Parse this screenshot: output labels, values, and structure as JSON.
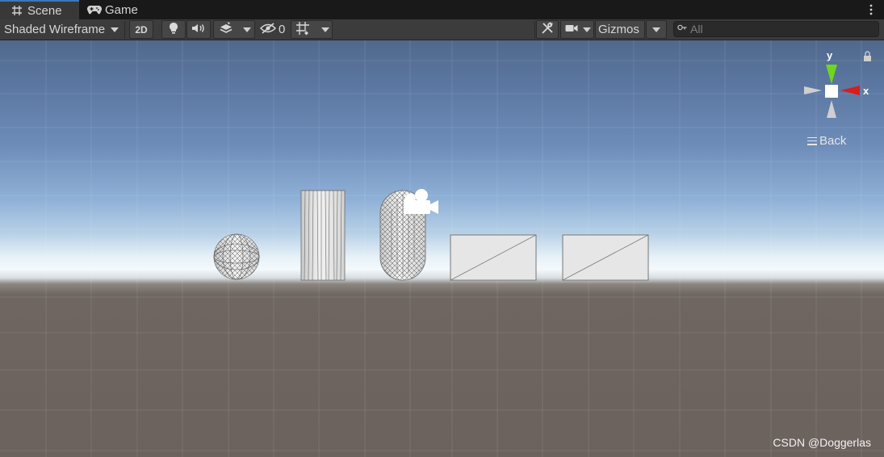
{
  "tabs": {
    "scene": {
      "label": "Scene",
      "icon": "grid-hash-icon",
      "active": true
    },
    "game": {
      "label": "Game",
      "icon": "gamepad-icon",
      "active": false
    }
  },
  "toolbar": {
    "draw_mode": "Shaded Wireframe",
    "mode_2d": "2D",
    "hidden_count": "0",
    "gizmos_label": "Gizmos",
    "search_placeholder": "All"
  },
  "viewport": {
    "back_label": "Back",
    "axis_x": "x",
    "axis_y": "y",
    "watermark": "CSDN @Doggerlas",
    "objects": [
      "sphere",
      "cylinder",
      "capsule",
      "cube",
      "cube"
    ]
  },
  "colors": {
    "accent_tab": "#3a79bb",
    "axis_x": "#d91d1d",
    "axis_y": "#6fd61f",
    "ground": "#6b615d",
    "sky": "#6d8cb8"
  }
}
